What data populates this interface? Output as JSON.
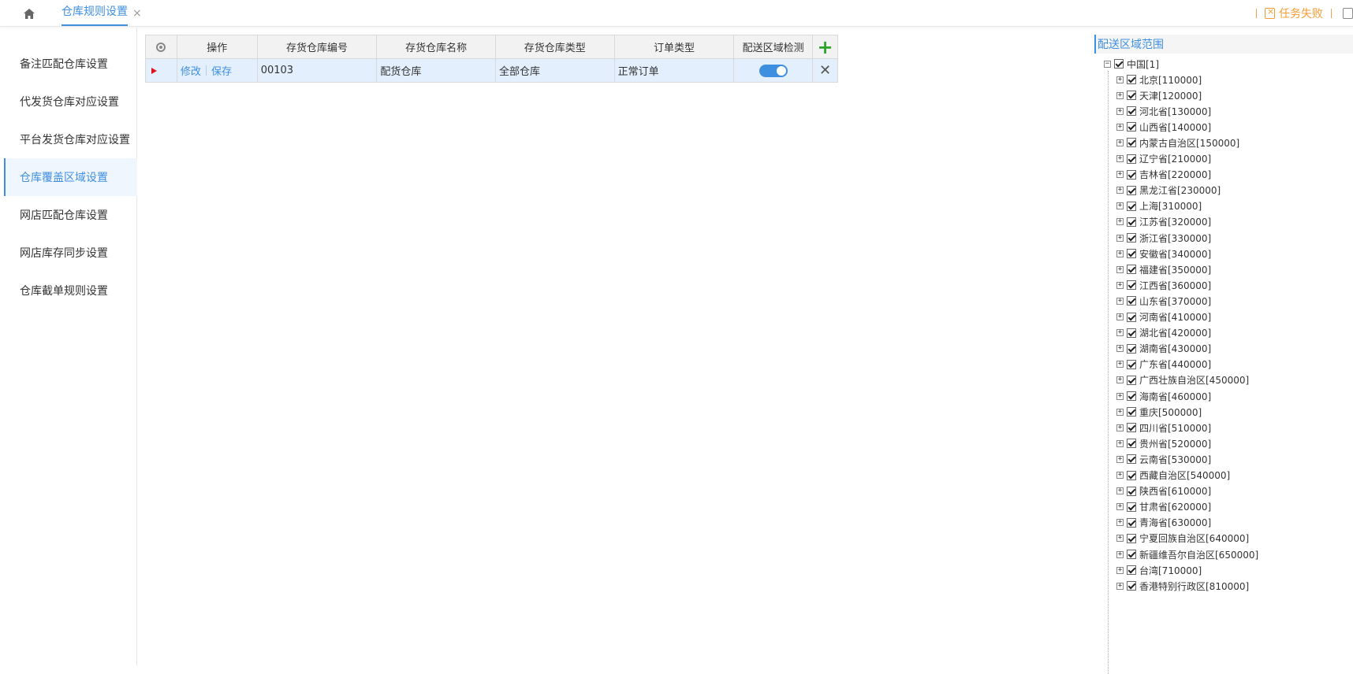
{
  "topbar": {
    "home_icon": "home-icon",
    "tab_label": "仓库规则设置",
    "tab_close": "×",
    "task_fail_label": "任务失败"
  },
  "sidebar": {
    "items": [
      {
        "label": "备注匹配仓库设置"
      },
      {
        "label": "代发货仓库对应设置"
      },
      {
        "label": "平台发货仓库对应设置"
      },
      {
        "label": "仓库覆盖区域设置",
        "active": true
      },
      {
        "label": "网店匹配仓库设置"
      },
      {
        "label": "网店库存同步设置"
      },
      {
        "label": "仓库截单规则设置"
      }
    ]
  },
  "grid": {
    "headers": [
      "操作",
      "存货仓库编号",
      "存货仓库名称",
      "存货仓库类型",
      "订单类型",
      "配送区域检测"
    ],
    "row": {
      "edit_label": "修改",
      "save_label": "保存",
      "warehouse_code": "00103",
      "warehouse_name": "配货仓库",
      "warehouse_type": "全部仓库",
      "order_type": "正常订单",
      "delivery_check_on": true
    },
    "add_label": "+",
    "delete_label": "✕"
  },
  "tree": {
    "title": "配送区域范围",
    "root": "中国[1]",
    "items": [
      "北京[110000]",
      "天津[120000]",
      "河北省[130000]",
      "山西省[140000]",
      "内蒙古自治区[150000]",
      "辽宁省[210000]",
      "吉林省[220000]",
      "黑龙江省[230000]",
      "上海[310000]",
      "江苏省[320000]",
      "浙江省[330000]",
      "安徽省[340000]",
      "福建省[350000]",
      "江西省[360000]",
      "山东省[370000]",
      "河南省[410000]",
      "湖北省[420000]",
      "湖南省[430000]",
      "广东省[440000]",
      "广西壮族自治区[450000]",
      "海南省[460000]",
      "重庆[500000]",
      "四川省[510000]",
      "贵州省[520000]",
      "云南省[530000]",
      "西藏自治区[540000]",
      "陕西省[610000]",
      "甘肃省[620000]",
      "青海省[630000]",
      "宁夏回族自治区[640000]",
      "新疆维吾尔自治区[650000]",
      "台湾[710000]",
      "香港特别行政区[810000]"
    ]
  },
  "colors": {
    "accent": "#3f8fe0",
    "warning": "#f39c33",
    "add": "#2aa52a",
    "row_marker": "#e0101d"
  }
}
